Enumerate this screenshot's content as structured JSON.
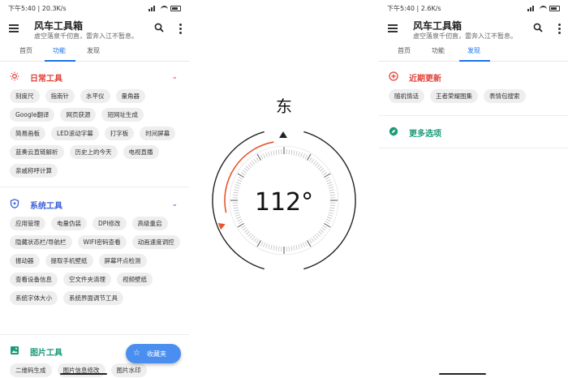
{
  "status_left": {
    "time_speed": "下午5:40 | 20.3K/s"
  },
  "status_right": {
    "time_speed": "下午5:40 | 2.6K/s"
  },
  "app": {
    "title": "风车工具箱",
    "subtitle": "虚空落泉千仞直，雷奔入江不暂息。"
  },
  "tabs": [
    "首页",
    "功能",
    "发现"
  ],
  "left": {
    "sections": [
      {
        "title": "日常工具",
        "color": "#e0443a",
        "icon": "sun-icon",
        "chips": [
          "刻度尺",
          "指南针",
          "水平仪",
          "量角器",
          "Google翻译",
          "网页获源",
          "短网址生成",
          "简易画板",
          "LED滚动字幕",
          "打字板",
          "时间屏幕",
          "蓝奏云直链解析",
          "历史上的今天",
          "电视直播",
          "亲戚称呼计算"
        ]
      },
      {
        "title": "系统工具",
        "color": "#3a5fd9",
        "icon": "shield-icon",
        "chips": [
          "应用管理",
          "电量伪装",
          "DPI修改",
          "高级重启",
          "隐藏状态栏/导航栏",
          "WIFI密码查看",
          "动画速度调控",
          "振动器",
          "提取手机壁纸",
          "屏幕坏点检测",
          "查看设备信息",
          "空文件夹清理",
          "视频壁纸",
          "系统字体大小",
          "系统界面调节工具"
        ]
      },
      {
        "title": "图片工具",
        "color": "#1a9a78",
        "icon": "image-icon",
        "chips": [
          "二维码生成",
          "图片信息修改",
          "图片水印"
        ]
      }
    ],
    "fab_label": "收藏夹"
  },
  "compass": {
    "direction": "东",
    "degree": "112°",
    "heading": 112,
    "accent": "#e8542e"
  },
  "right": {
    "recent_title": "近期更新",
    "recent_color": "#e0443a",
    "recent_chips": [
      "随机情话",
      "王者荣耀图集",
      "表情包搜索"
    ],
    "more_title": "更多选项",
    "more_color": "#1a9a78"
  }
}
